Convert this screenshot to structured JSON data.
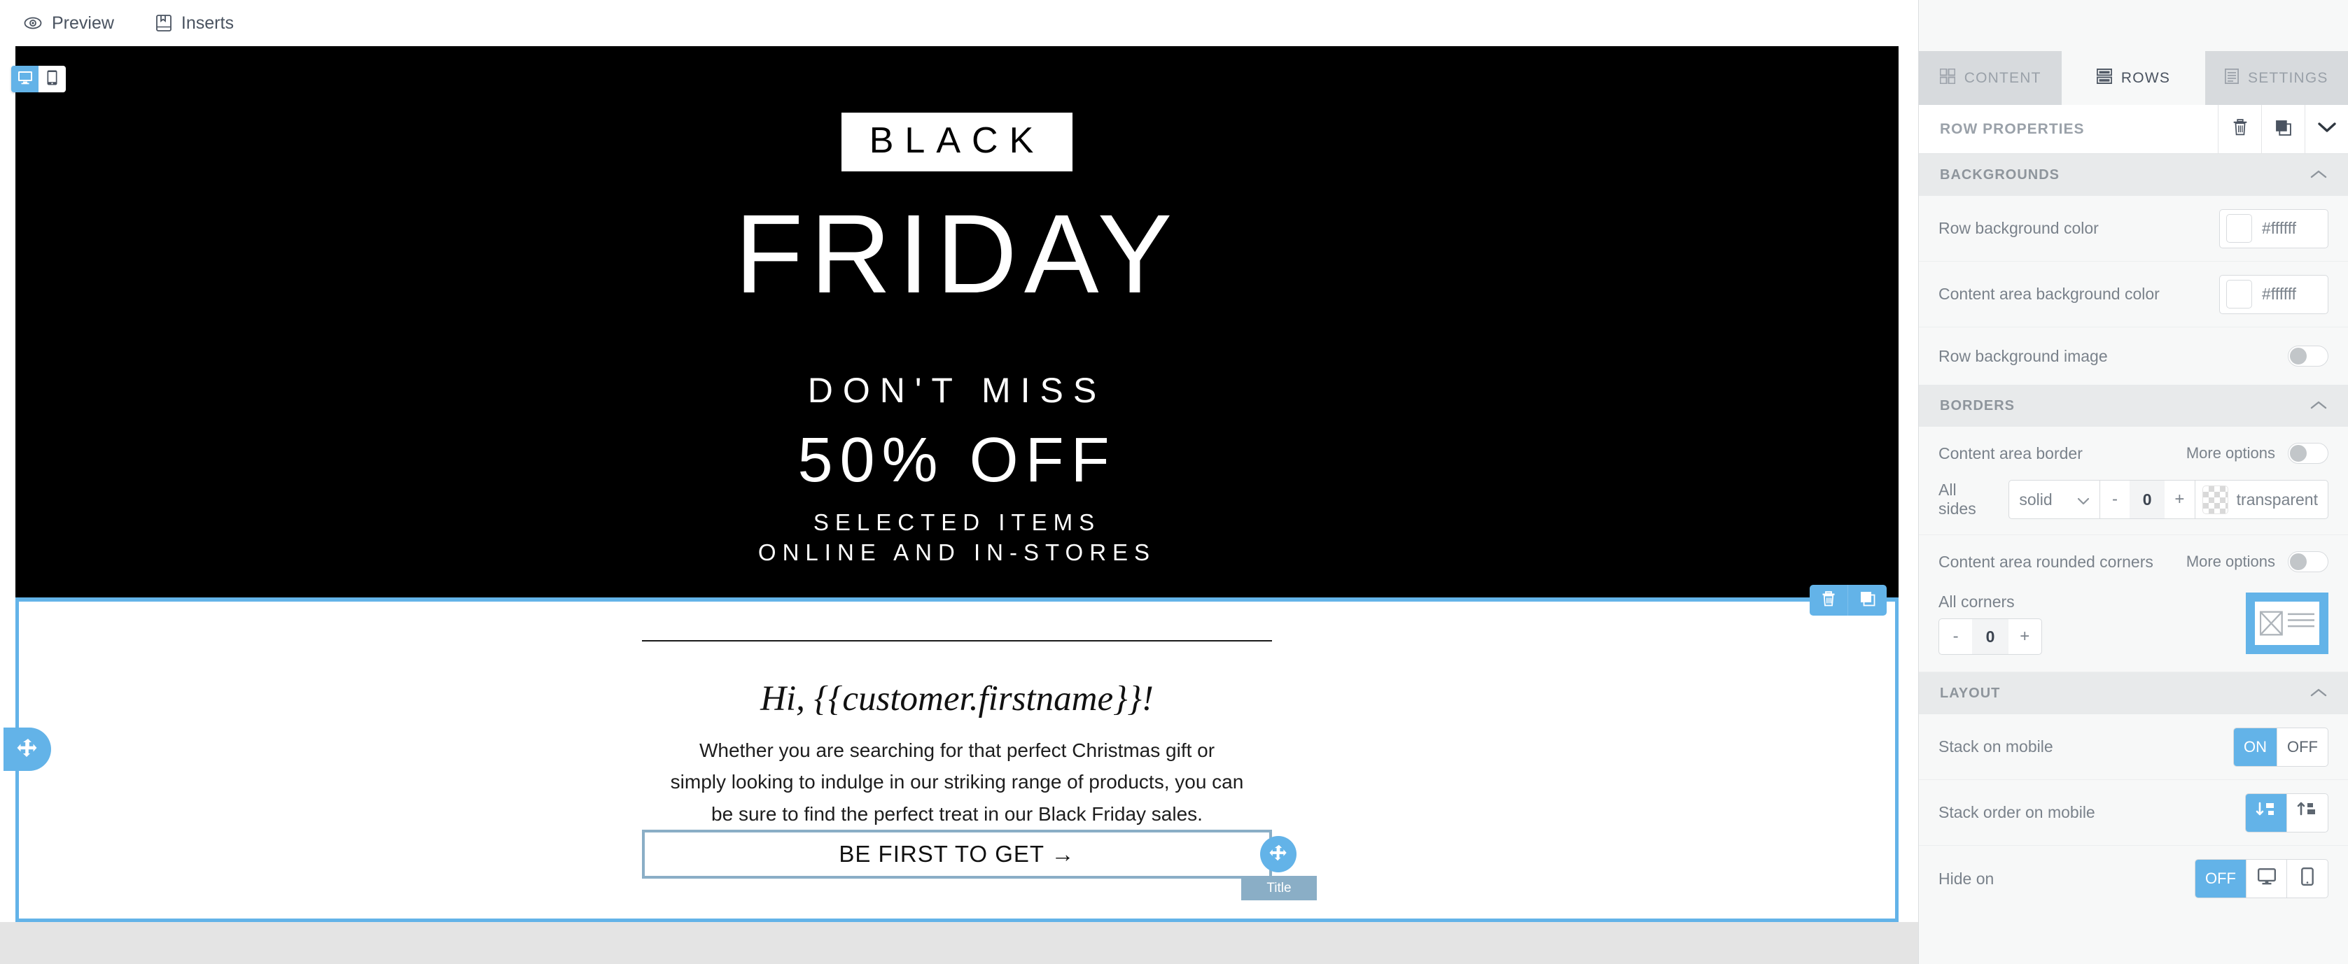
{
  "toolbar": {
    "preview_label": "Preview",
    "inserts_label": "Inserts"
  },
  "device_switch": {
    "desktop_icon": "desktop-icon",
    "mobile_icon": "mobile-icon",
    "active": "desktop"
  },
  "email": {
    "hero": {
      "badge": "BLACK",
      "headline": "FRIDAY",
      "kicker": "DON'T MISS",
      "offer": "50% OFF",
      "sub_line1": "SELECTED ITEMS",
      "sub_line2": "ONLINE AND IN-STORES",
      "background_color": "#000000",
      "text_color": "#ffffff"
    },
    "content": {
      "greeting": "Hi, {{customer.firstname}}!",
      "paragraph": "Whether you are searching for that perfect Christmas gift or simply looking to indulge in our striking range of products, you can be sure to find the perfect treat in our Black Friday sales.",
      "cta_label": "BE FIRST TO GET →",
      "element_badge": "Title"
    },
    "selection_color": "#63b3e8"
  },
  "panel": {
    "tabs": [
      {
        "label": "CONTENT",
        "icon": "grid-icon",
        "active": false
      },
      {
        "label": "ROWS",
        "icon": "rows-icon",
        "active": true
      },
      {
        "label": "SETTINGS",
        "icon": "document-icon",
        "active": false
      }
    ],
    "row_properties": {
      "title": "ROW PROPERTIES",
      "delete_icon": "trash-icon",
      "duplicate_icon": "copy-icon",
      "collapse_icon": "chevron-down-icon"
    },
    "backgrounds": {
      "title": "BACKGROUNDS",
      "row_background_color_label": "Row background color",
      "row_background_color_value": "#ffffff",
      "content_area_background_color_label": "Content area background color",
      "content_area_background_color_value": "#ffffff",
      "row_background_image_label": "Row background image",
      "row_background_image_toggle": "off"
    },
    "borders": {
      "title": "BORDERS",
      "content_area_border_label": "Content area border",
      "more_options_label": "More options",
      "more_options_toggle": "off",
      "all_sides_label": "All sides",
      "style_value": "solid",
      "width_value": "0",
      "minus_label": "-",
      "plus_label": "+",
      "color_value": "transparent"
    },
    "rounded": {
      "content_area_rounded_corners_label": "Content area rounded corners",
      "more_options_label": "More options",
      "more_options_toggle": "off",
      "all_corners_label": "All corners",
      "radius_value": "0",
      "minus_label": "-",
      "plus_label": "+"
    },
    "layout": {
      "title": "LAYOUT",
      "stack_on_mobile_label": "Stack on mobile",
      "stack_on_mobile_on": "ON",
      "stack_on_mobile_off": "OFF",
      "stack_on_mobile_value": "ON",
      "stack_order_label": "Stack order on mobile",
      "stack_order_value": "down",
      "hide_on_label": "Hide on",
      "hide_on_off": "OFF",
      "hide_on_value": "OFF"
    }
  }
}
